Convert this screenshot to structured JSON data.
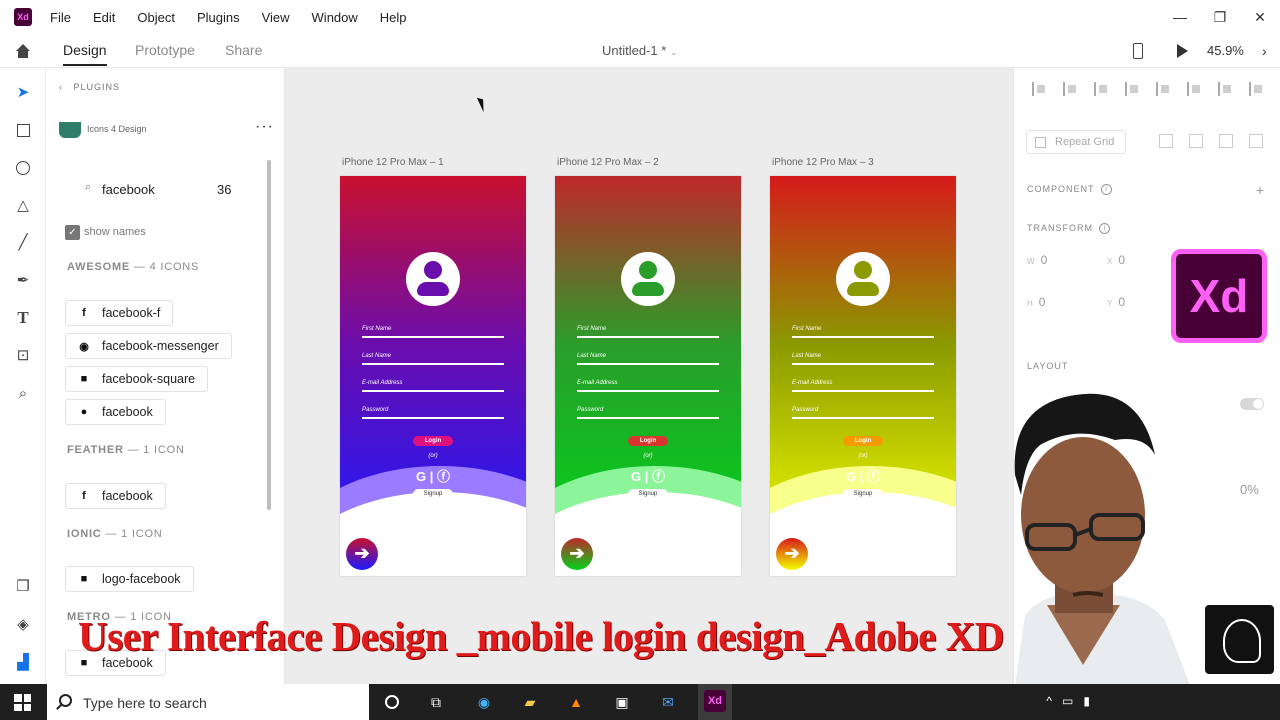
{
  "menubar": {
    "app_icon": "Xd",
    "items": [
      "File",
      "Edit",
      "Object",
      "Plugins",
      "View",
      "Window",
      "Help"
    ],
    "window_controls": [
      "minimize-icon",
      "restore-icon",
      "close-icon"
    ]
  },
  "modebar": {
    "tabs": [
      "Design",
      "Prototype",
      "Share"
    ],
    "active_tab": "Design",
    "doc_title": "Untitled-1 *",
    "zoom": "45.9%"
  },
  "plugins": {
    "header": "PLUGINS",
    "plugin_name": "Icons 4 Design",
    "search_value": "facebook",
    "result_count": "36",
    "show_names_label": "show names",
    "show_names_checked": true,
    "sections": [
      {
        "title": "AWESOME",
        "count": "— 4 ICONS",
        "icons": [
          {
            "glyph": "f",
            "label": "facebook-f"
          },
          {
            "glyph": "◉",
            "label": "facebook-messenger"
          },
          {
            "glyph": "■",
            "label": "facebook-square"
          },
          {
            "glyph": "●",
            "label": "facebook"
          }
        ]
      },
      {
        "title": "FEATHER",
        "count": "— 1 ICON",
        "icons": [
          {
            "glyph": "f",
            "label": "facebook"
          }
        ]
      },
      {
        "title": "IONIC",
        "count": "— 1 ICON",
        "icons": [
          {
            "glyph": "■",
            "label": "logo-facebook"
          }
        ]
      },
      {
        "title": "METRO",
        "count": "— 1 ICON",
        "icons": [
          {
            "glyph": "■",
            "label": "facebook"
          }
        ]
      }
    ]
  },
  "artboards": [
    {
      "label": "iPhone 12 Pro Max – 1",
      "top_color": "#c8102e",
      "bottom_color": "#1a1aff",
      "accent": "#6a0dad",
      "wave": "#9b7bff",
      "login_color": "#e0117f"
    },
    {
      "label": "iPhone 12 Pro Max – 2",
      "top_color": "#c0282a",
      "bottom_color": "#00d41a",
      "accent": "#2a9d2a",
      "wave": "#8cf59a",
      "login_color": "#d7372e"
    },
    {
      "label": "iPhone 12 Pro Max – 3",
      "top_color": "#d61a1a",
      "bottom_color": "#f4ff00",
      "accent": "#8a9a00",
      "wave": "#f8ff8a",
      "login_color": "#f59a00"
    }
  ],
  "form": {
    "fields": [
      "First Name",
      "Last Name",
      "E-mail Address",
      "Password"
    ],
    "login": "Login",
    "or": "(or)",
    "social": "G | ⓕ",
    "signup": "Signup",
    "arrow": "➔"
  },
  "rightpanel": {
    "repeat_grid": "Repeat Grid",
    "component": "COMPONENT",
    "transform": "TRANSFORM",
    "w_label": "W",
    "w_value": "0",
    "x_label": "X",
    "x_value": "0",
    "h_label": "H",
    "h_value": "0",
    "y_label": "Y",
    "y_value": "0",
    "layout": "LAYOUT",
    "opacity": "0%",
    "xd_logo": "Xd"
  },
  "banner": "User Interface Design _mobile login design_Adobe XD",
  "taskbar": {
    "search_placeholder": "Type here to search",
    "xd": "Xd"
  }
}
